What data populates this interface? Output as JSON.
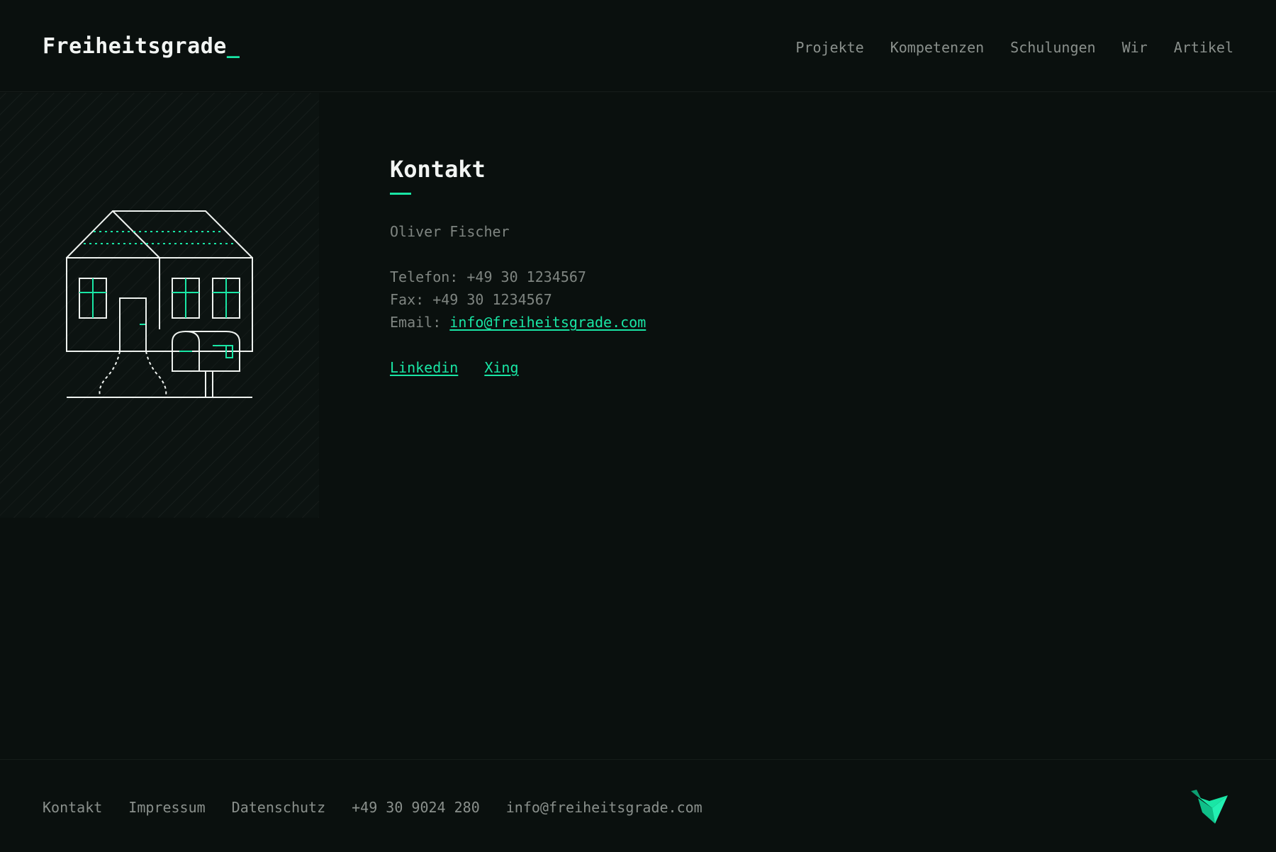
{
  "header": {
    "logo_text": "Freiheitsgrade",
    "logo_cursor": "_",
    "nav": [
      {
        "label": "Projekte"
      },
      {
        "label": "Kompetenzen"
      },
      {
        "label": "Schulungen"
      },
      {
        "label": "Wir"
      },
      {
        "label": "Artikel"
      }
    ]
  },
  "illustration": {
    "icon": "house-with-mailbox-icon"
  },
  "contact": {
    "heading": "Kontakt",
    "name": "Oliver Fischer",
    "phone": "Telefon: +49 30 1234567",
    "fax": "Fax: +49 30 1234567",
    "email_label": "Email: ",
    "email": "info@freiheitsgrade.com",
    "social": [
      {
        "label": "Linkedin"
      },
      {
        "label": "Xing"
      }
    ]
  },
  "footer": {
    "links": [
      {
        "label": "Kontakt"
      },
      {
        "label": "Impressum"
      },
      {
        "label": "Datenschutz"
      },
      {
        "label": "+49 30 9024 280"
      },
      {
        "label": "info@freiheitsgrade.com"
      }
    ],
    "logo_icon": "origami-bird-icon"
  },
  "colors": {
    "background": "#0a100e",
    "accent": "#19e6a5",
    "text": "#8a908c",
    "heading": "#f2f5f3"
  }
}
